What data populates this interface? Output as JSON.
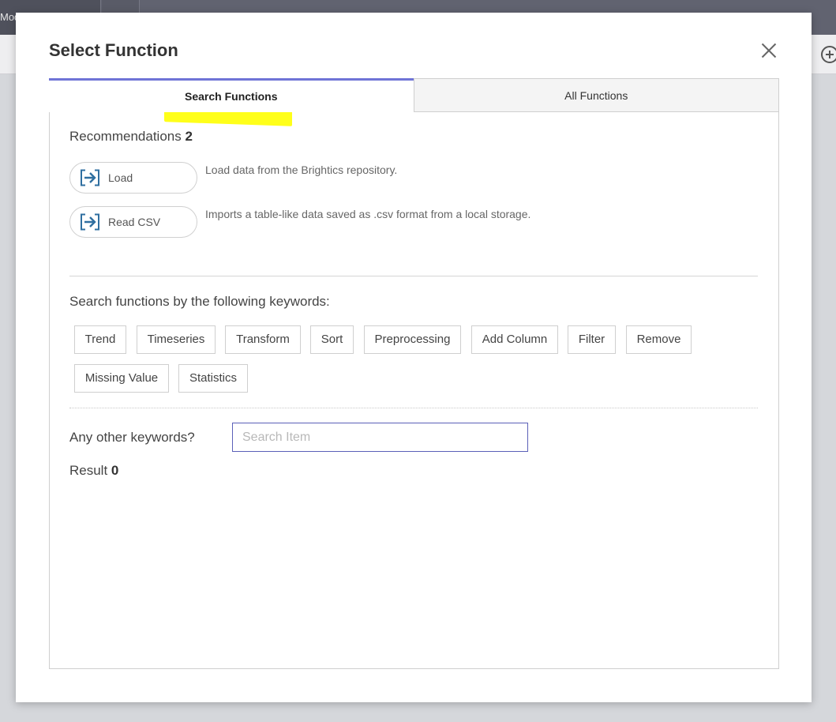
{
  "background": {
    "tab_label": "Mod",
    "tab2_label": "+"
  },
  "dialog": {
    "title": "Select Function",
    "tabs": [
      {
        "label": "Search Functions",
        "active": true
      },
      {
        "label": "All Functions",
        "active": false
      }
    ],
    "recommendations": {
      "title": "Recommendations",
      "count": "2",
      "items": [
        {
          "label": "Load",
          "description": "Load data from the Brightics repository."
        },
        {
          "label": "Read CSV",
          "description": "Imports a table-like data saved as .csv format from a local storage."
        }
      ]
    },
    "keywords": {
      "title": "Search functions by the following keywords:",
      "items": [
        "Trend",
        "Timeseries",
        "Transform",
        "Sort",
        "Preprocessing",
        "Add Column",
        "Filter",
        "Remove",
        "Missing Value",
        "Statistics"
      ]
    },
    "other": {
      "label": "Any other keywords?",
      "placeholder": "Search Item",
      "value": ""
    },
    "result": {
      "label": "Result",
      "count": "0"
    }
  },
  "colors": {
    "accent": "#6f74d6",
    "highlight": "#ffff1a",
    "icon": "#2f6fa0"
  }
}
